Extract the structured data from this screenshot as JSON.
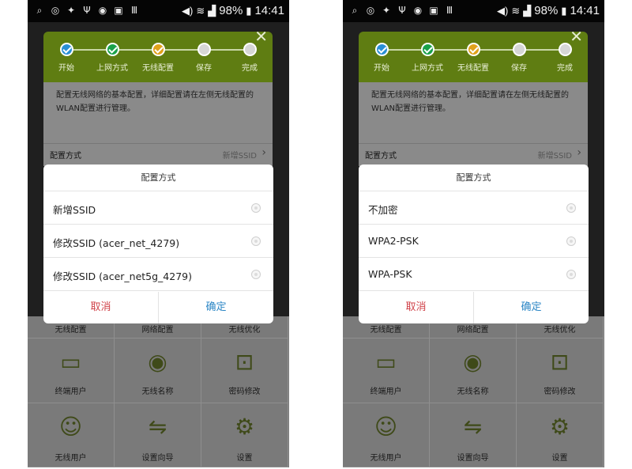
{
  "status_bar": {
    "battery": "98%",
    "time": "14:41"
  },
  "wizard": {
    "steps": [
      "开始",
      "上网方式",
      "无线配置",
      "保存",
      "完成"
    ],
    "step_colors": [
      "#2a8fd6",
      "#1aa14a",
      "#e0a11b",
      "#d6d6d6",
      "#d6d6d6"
    ],
    "description": "配置无线网络的基本配置，详细配置请在左侧无线配置的WLAN配置进行管理。",
    "config_label": "配置方式",
    "config_value": "新增SSID"
  },
  "grid": {
    "row0": [
      "无线配置",
      "网络配置",
      "无线优化"
    ],
    "row1": [
      "终端用户",
      "无线名称",
      "密码修改"
    ],
    "row2": [
      "无线用户",
      "设置向导",
      "设置"
    ]
  },
  "dialog_left": {
    "title": "配置方式",
    "options": [
      "新增SSID",
      "修改SSID (acer_net_4279)",
      "修改SSID (acer_net5g_4279)"
    ],
    "cancel": "取消",
    "ok": "确定"
  },
  "dialog_right": {
    "title": "配置方式",
    "options": [
      "不加密",
      "WPA2-PSK",
      "WPA-PSK"
    ],
    "cancel": "取消",
    "ok": "确定"
  },
  "icons": {
    "monitor": "monitor-phone-icon",
    "wifi": "wifi-icon",
    "lock": "lock-icon",
    "user": "user-icon",
    "signpost": "signpost-icon",
    "gear": "gear-icon"
  },
  "accent": "#5f7d12"
}
